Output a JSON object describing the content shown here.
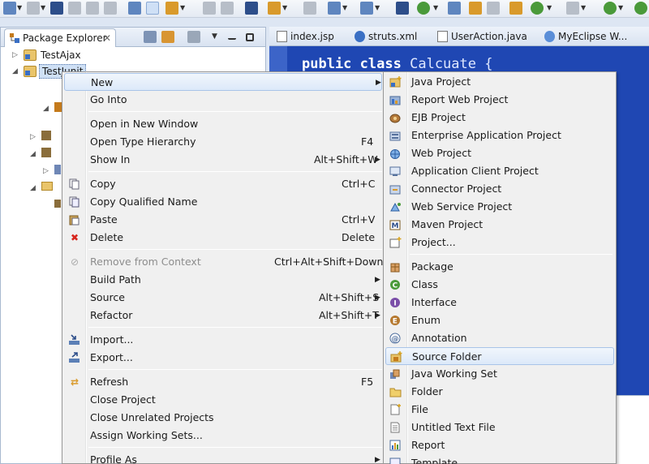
{
  "package_explorer": {
    "tab_title": "Package Explorer",
    "tree": [
      {
        "label": "TestAjax"
      },
      {
        "label": "TestJunit"
      }
    ]
  },
  "editor": {
    "tabs": [
      {
        "label": "index.jsp"
      },
      {
        "label": "struts.xml"
      },
      {
        "label": "UserAction.java"
      },
      {
        "label": "MyEclipse W..."
      }
    ],
    "code_line": {
      "kw1": "public",
      "kw2": "class",
      "name": "Calcuate {"
    }
  },
  "context_menu": {
    "items": [
      {
        "label": "New",
        "accel": ""
      },
      {
        "label": "Go Into",
        "accel": ""
      },
      {
        "label": "Open in New Window",
        "accel": ""
      },
      {
        "label": "Open Type Hierarchy",
        "accel": "F4"
      },
      {
        "label": "Show In",
        "accel": "Alt+Shift+W"
      },
      {
        "label": "Copy",
        "accel": "Ctrl+C"
      },
      {
        "label": "Copy Qualified Name",
        "accel": ""
      },
      {
        "label": "Paste",
        "accel": "Ctrl+V"
      },
      {
        "label": "Delete",
        "accel": "Delete"
      },
      {
        "label": "Remove from Context",
        "accel": "Ctrl+Alt+Shift+Down"
      },
      {
        "label": "Build Path",
        "accel": ""
      },
      {
        "label": "Source",
        "accel": "Alt+Shift+S"
      },
      {
        "label": "Refactor",
        "accel": "Alt+Shift+T"
      },
      {
        "label": "Import...",
        "accel": ""
      },
      {
        "label": "Export...",
        "accel": ""
      },
      {
        "label": "Refresh",
        "accel": "F5"
      },
      {
        "label": "Close Project",
        "accel": ""
      },
      {
        "label": "Close Unrelated Projects",
        "accel": ""
      },
      {
        "label": "Assign Working Sets...",
        "accel": ""
      },
      {
        "label": "Profile As",
        "accel": ""
      }
    ]
  },
  "new_submenu": {
    "items": [
      {
        "label": "Java Project"
      },
      {
        "label": "Report Web Project"
      },
      {
        "label": "EJB Project"
      },
      {
        "label": "Enterprise Application Project"
      },
      {
        "label": "Web Project"
      },
      {
        "label": "Application Client Project"
      },
      {
        "label": "Connector Project"
      },
      {
        "label": "Web Service Project"
      },
      {
        "label": "Maven Project"
      },
      {
        "label": "Project..."
      },
      {
        "label": "Package"
      },
      {
        "label": "Class"
      },
      {
        "label": "Interface"
      },
      {
        "label": "Enum"
      },
      {
        "label": "Annotation"
      },
      {
        "label": "Source Folder"
      },
      {
        "label": "Java Working Set"
      },
      {
        "label": "Folder"
      },
      {
        "label": "File"
      },
      {
        "label": "Untitled Text File"
      },
      {
        "label": "Report"
      },
      {
        "label": "Template"
      }
    ]
  },
  "colors": {
    "editor_bg": "#1f47b3",
    "menu_bg": "#f0f0f0",
    "highlight": "#dce9f9",
    "delete_icon": "#d7261e"
  }
}
